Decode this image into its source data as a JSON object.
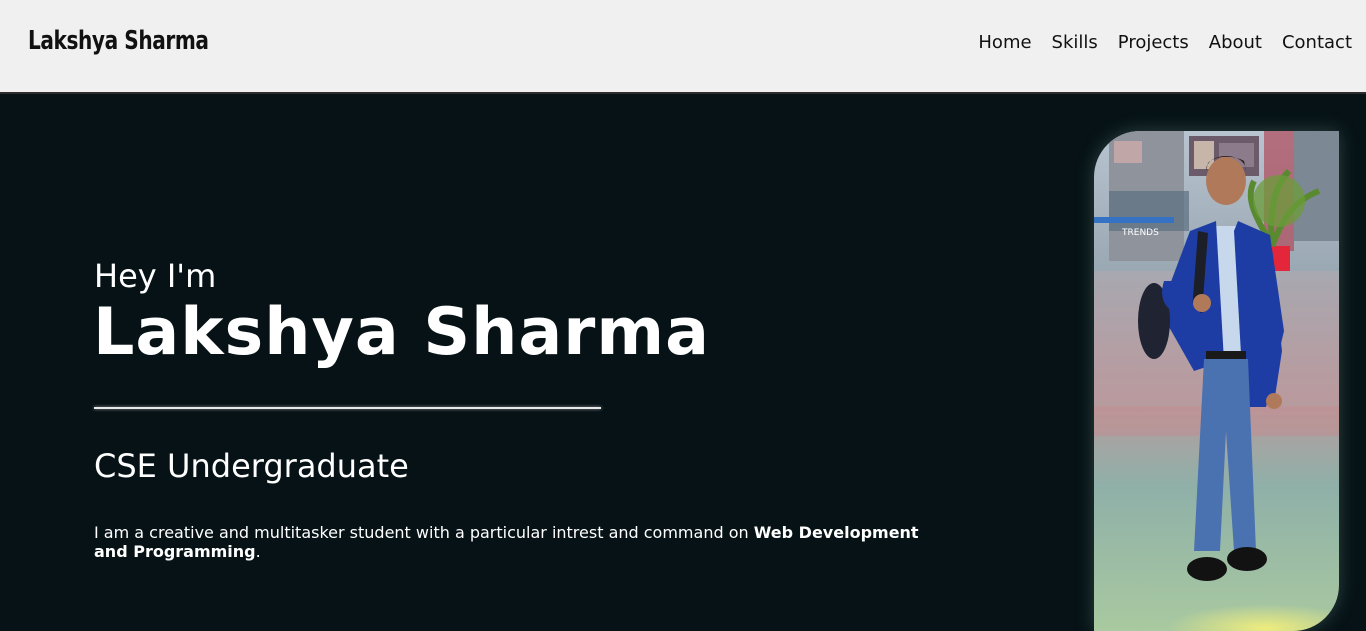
{
  "navbar": {
    "brand": "Lakshya Sharma",
    "links": [
      "Home",
      "Skills",
      "Projects",
      "About",
      "Contact"
    ]
  },
  "hero": {
    "greeting": "Hey I'm",
    "name": "Lakshya Sharma",
    "role": "CSE Undergraduate",
    "bio_prefix": "I am a creative and multitasker student with a particular intrest and command on ",
    "bio_highlight": "Web Development and Programming",
    "bio_suffix": "."
  },
  "colors": {
    "navbar_bg": "#f0f0f0",
    "hero_bg": "#061216",
    "text_light": "#ffffff"
  }
}
